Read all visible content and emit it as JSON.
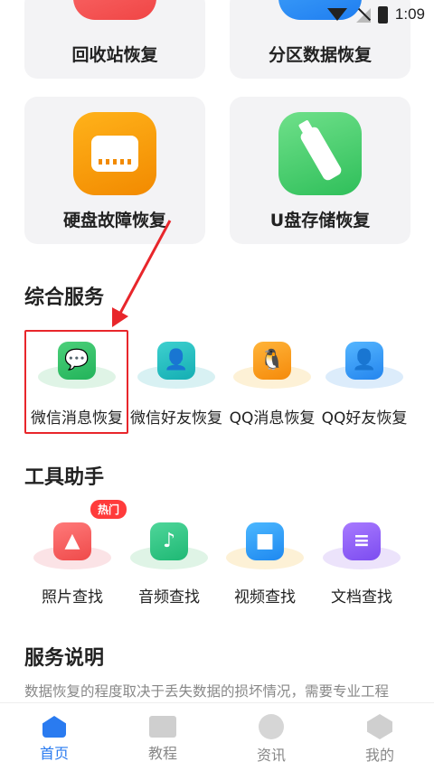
{
  "status_bar": {
    "time": "1:09"
  },
  "top_cards": [
    {
      "label": "回收站恢复",
      "color": "#f04545"
    },
    {
      "label": "分区数据恢复",
      "color": "#1f7df0"
    },
    {
      "label": "硬盘故障恢复",
      "color": "#f28a00"
    },
    {
      "label": "U盘存储恢复",
      "color": "#2fbf5a"
    }
  ],
  "sections": {
    "integrated_services": "综合服务",
    "tools": "工具助手",
    "service_notes": "服务说明"
  },
  "integrated_services": [
    {
      "label": "微信消息恢复",
      "icon": "wechat-icon"
    },
    {
      "label": "微信好友恢复",
      "icon": "contact-card-icon"
    },
    {
      "label": "QQ消息恢复",
      "icon": "qq-icon"
    },
    {
      "label": "QQ好友恢复",
      "icon": "user-icon"
    }
  ],
  "tools": [
    {
      "label": "照片查找",
      "icon": "photo-icon",
      "badge": "热门"
    },
    {
      "label": "音频查找",
      "icon": "music-icon"
    },
    {
      "label": "视频查找",
      "icon": "video-icon"
    },
    {
      "label": "文档查找",
      "icon": "document-icon"
    }
  ],
  "service_notes_text": "数据恢复的程度取决于丢失数据的损坏情况，需要专业工程",
  "bottom_nav": [
    {
      "label": "首页",
      "active": true
    },
    {
      "label": "教程",
      "active": false
    },
    {
      "label": "资讯",
      "active": false
    },
    {
      "label": "我的",
      "active": false
    }
  ],
  "accent_color": "#2a7bf0",
  "highlight_color": "#e8262b"
}
